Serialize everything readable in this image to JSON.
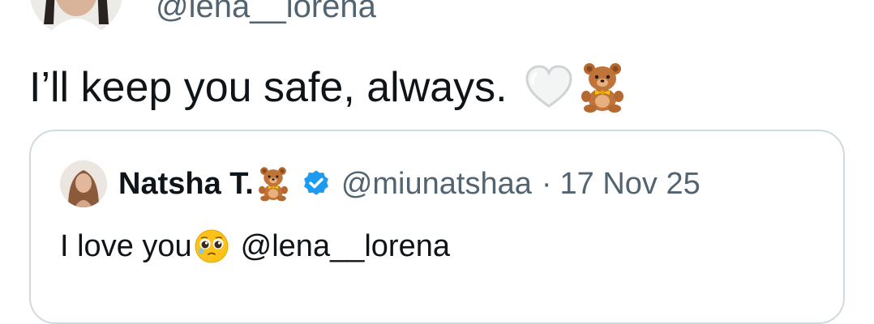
{
  "tweet": {
    "handle": "@lena__lorena",
    "text": "I’ll keep you safe, always.",
    "text_emojis": [
      "white-heart-icon",
      "teddy-bear-icon"
    ]
  },
  "quote": {
    "author_name": "Natsha T.",
    "author_name_emoji": "teddy-bear-icon",
    "verified_icon": "verified-badge-icon",
    "handle": "@miunatshaa",
    "separator": "·",
    "date": "17 Nov 25",
    "text": "I love you",
    "text_emoji": "pleading-face-icon",
    "mention": "@lena__lorena"
  },
  "colors": {
    "text_primary": "#0f1419",
    "text_secondary": "#536471",
    "card_border": "#cfd9de",
    "verified_blue": "#1d9bf0"
  }
}
